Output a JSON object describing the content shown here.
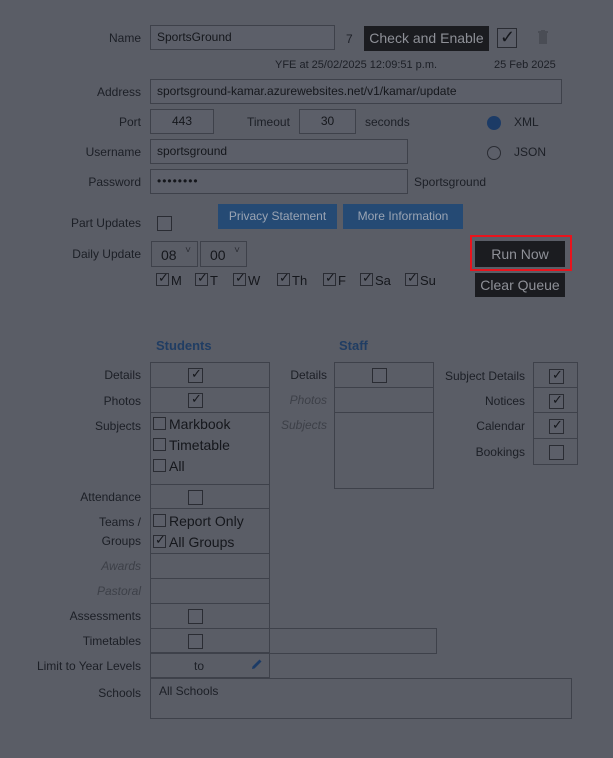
{
  "form": {
    "name_label": "Name",
    "name_value": "SportsGround",
    "id_value": "7",
    "check_enable_label": "Check and Enable",
    "yfe_text": "YFE at 25/02/2025 12:09:51 p.m.",
    "date_text": "25 Feb 2025",
    "address_label": "Address",
    "address_value": "sportsground-kamar.azurewebsites.net/v1/kamar/update",
    "port_label": "Port",
    "port_value": "443",
    "timeout_label": "Timeout",
    "timeout_value": "30",
    "seconds_label": "seconds",
    "format_xml": "XML",
    "format_json": "JSON",
    "username_label": "Username",
    "username_value": "sportsground",
    "password_label": "Password",
    "password_value": "••••••••",
    "password_owner": "Sportsground",
    "part_updates_label": "Part Updates",
    "privacy_label": "Privacy Statement",
    "more_info_label": "More Information",
    "daily_update_label": "Daily Update",
    "hour_value": "08",
    "minute_value": "00",
    "run_now_label": "Run Now",
    "clear_queue_label": "Clear Queue",
    "days": [
      "M",
      "T",
      "W",
      "Th",
      "F",
      "Sa",
      "Su"
    ]
  },
  "students": {
    "heading": "Students",
    "details_label": "Details",
    "photos_label": "Photos",
    "subjects_label": "Subjects",
    "markbook_label": "Markbook",
    "timetable_label": "Timetable",
    "all_label": "All",
    "attendance_label": "Attendance",
    "teams_label_1": "Teams /",
    "teams_label_2": "Groups",
    "report_only_label": "Report Only",
    "all_groups_label": "All Groups",
    "awards_label": "Awards",
    "pastoral_label": "Pastoral",
    "assessments_label": "Assessments",
    "timetables_label": "Timetables",
    "limit_label": "Limit to Year Levels",
    "to_label": "to",
    "schools_label": "Schools",
    "schools_value": "All Schools"
  },
  "staff": {
    "heading": "Staff",
    "details_label": "Details",
    "photos_label": "Photos",
    "subjects_label": "Subjects"
  },
  "other": {
    "subject_details_label": "Subject Details",
    "notices_label": "Notices",
    "calendar_label": "Calendar",
    "bookings_label": "Bookings"
  },
  "icons": {
    "pencil": "pencil-icon",
    "trash": "trash-icon",
    "chevron": "chevron-down-icon"
  },
  "colors": {
    "overlay_bg": "#5a5d66",
    "highlight_red": "#e8141d",
    "button_dark": "#1b1c20",
    "button_blue": "#254a74",
    "radio_selected": "#1c3b66",
    "section_heading": "#203d63"
  }
}
